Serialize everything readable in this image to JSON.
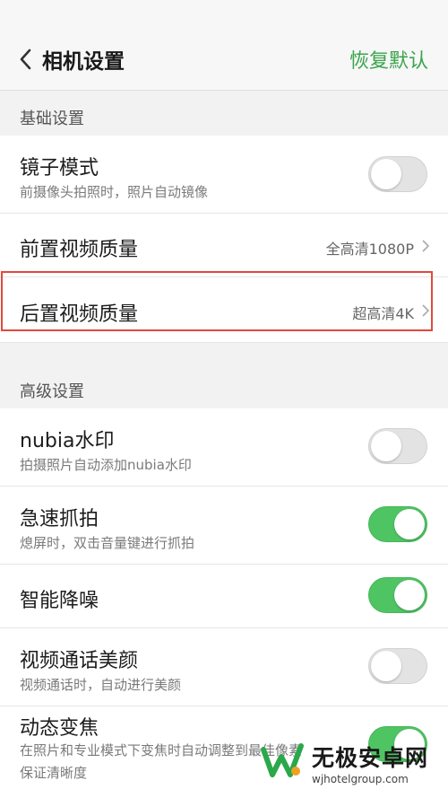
{
  "header": {
    "title": "相机设置",
    "reset_label": "恢复默认",
    "accent": "#3aa44d"
  },
  "sections": [
    {
      "title": "基础设置",
      "items": [
        {
          "label": "镜子模式",
          "subtitle": "前摄像头拍照时，照片自动镜像",
          "toggle": false
        },
        {
          "label": "前置视频质量",
          "value": "全高清1080P"
        },
        {
          "label": "后置视频质量",
          "value": "超高清4K"
        }
      ]
    },
    {
      "title": "高级设置",
      "items": [
        {
          "label": "nubia水印",
          "subtitle": "拍摄照片自动添加nubia水印",
          "toggle": false
        },
        {
          "label": "急速抓拍",
          "subtitle": "熄屏时，双击音量键进行抓拍",
          "toggle": true
        },
        {
          "label": "智能降噪",
          "toggle": true
        },
        {
          "label": "视频通话美颜",
          "subtitle": "视频通话时，自动进行美颜",
          "toggle": false
        },
        {
          "label": "动态变焦",
          "subtitle": "在照片和专业模式下变焦时自动调整到最佳像素",
          "subtitle2": "保证清晰度",
          "toggle": true
        }
      ]
    }
  ],
  "watermark": {
    "name": "无极安卓网",
    "url": "wjhotelgroup.com"
  },
  "colors": {
    "toggle_on": "#4fc463",
    "toggle_off": "#e3e3e3",
    "highlight": "#e04a3c"
  }
}
